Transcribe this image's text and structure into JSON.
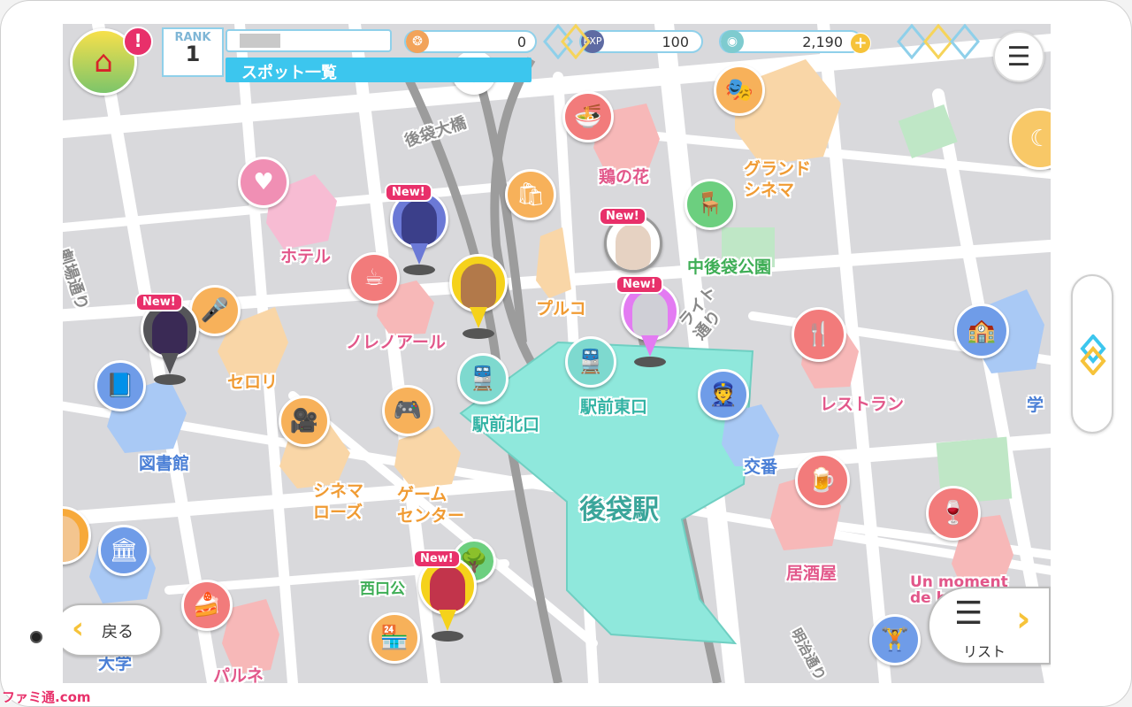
{
  "header": {
    "rank_caption": "RANK",
    "rank_value": "1",
    "tab_label": "スポット一覧",
    "alert_badge": "!"
  },
  "currencies": [
    {
      "name": "paw-icon",
      "value": "0"
    },
    {
      "name": "exp-icon",
      "value": "100"
    },
    {
      "name": "coin-icon",
      "value": "2,190"
    }
  ],
  "spots": {
    "hotel": "ホテル",
    "noir": "ノレノアール",
    "celery": "セロリ",
    "library": "図書館",
    "cinema_rose": "シネマ\nローズ",
    "game_center": "ゲーム\nセンター",
    "north_exit": "駅前北口",
    "east_exit": "駅前東口",
    "station": "後袋駅",
    "plco": "プルコ",
    "bridge": "後袋大橋",
    "torinohana": "鶏の花",
    "grand_cinema": "グランド\nシネマ",
    "park": "中後袋公園",
    "light_street": "ライト\n通り",
    "restaurant": "レストラン",
    "police": "交番",
    "izakaya": "居酒屋",
    "west_park": "西口公",
    "school": "学",
    "university": "大学",
    "parune": "パルネ",
    "cafe_french": "Un moment\nde bonheur",
    "street_left": "劇場通り",
    "street_bottom": "明治通り"
  },
  "pins": {
    "new_label": "New!"
  },
  "buttons": {
    "back_label": "戻る",
    "list_label": "リスト"
  },
  "colors": {
    "station_area": "#8fe8dc",
    "pin_purple": "#e37bf2",
    "pin_yellow": "#f5d21b",
    "pin_blue": "#6b79d6",
    "pin_gray": "#555559",
    "new_badge": "#e8306a",
    "tab_bar": "#3cc6ee"
  },
  "watermark": "ファミ通.com"
}
